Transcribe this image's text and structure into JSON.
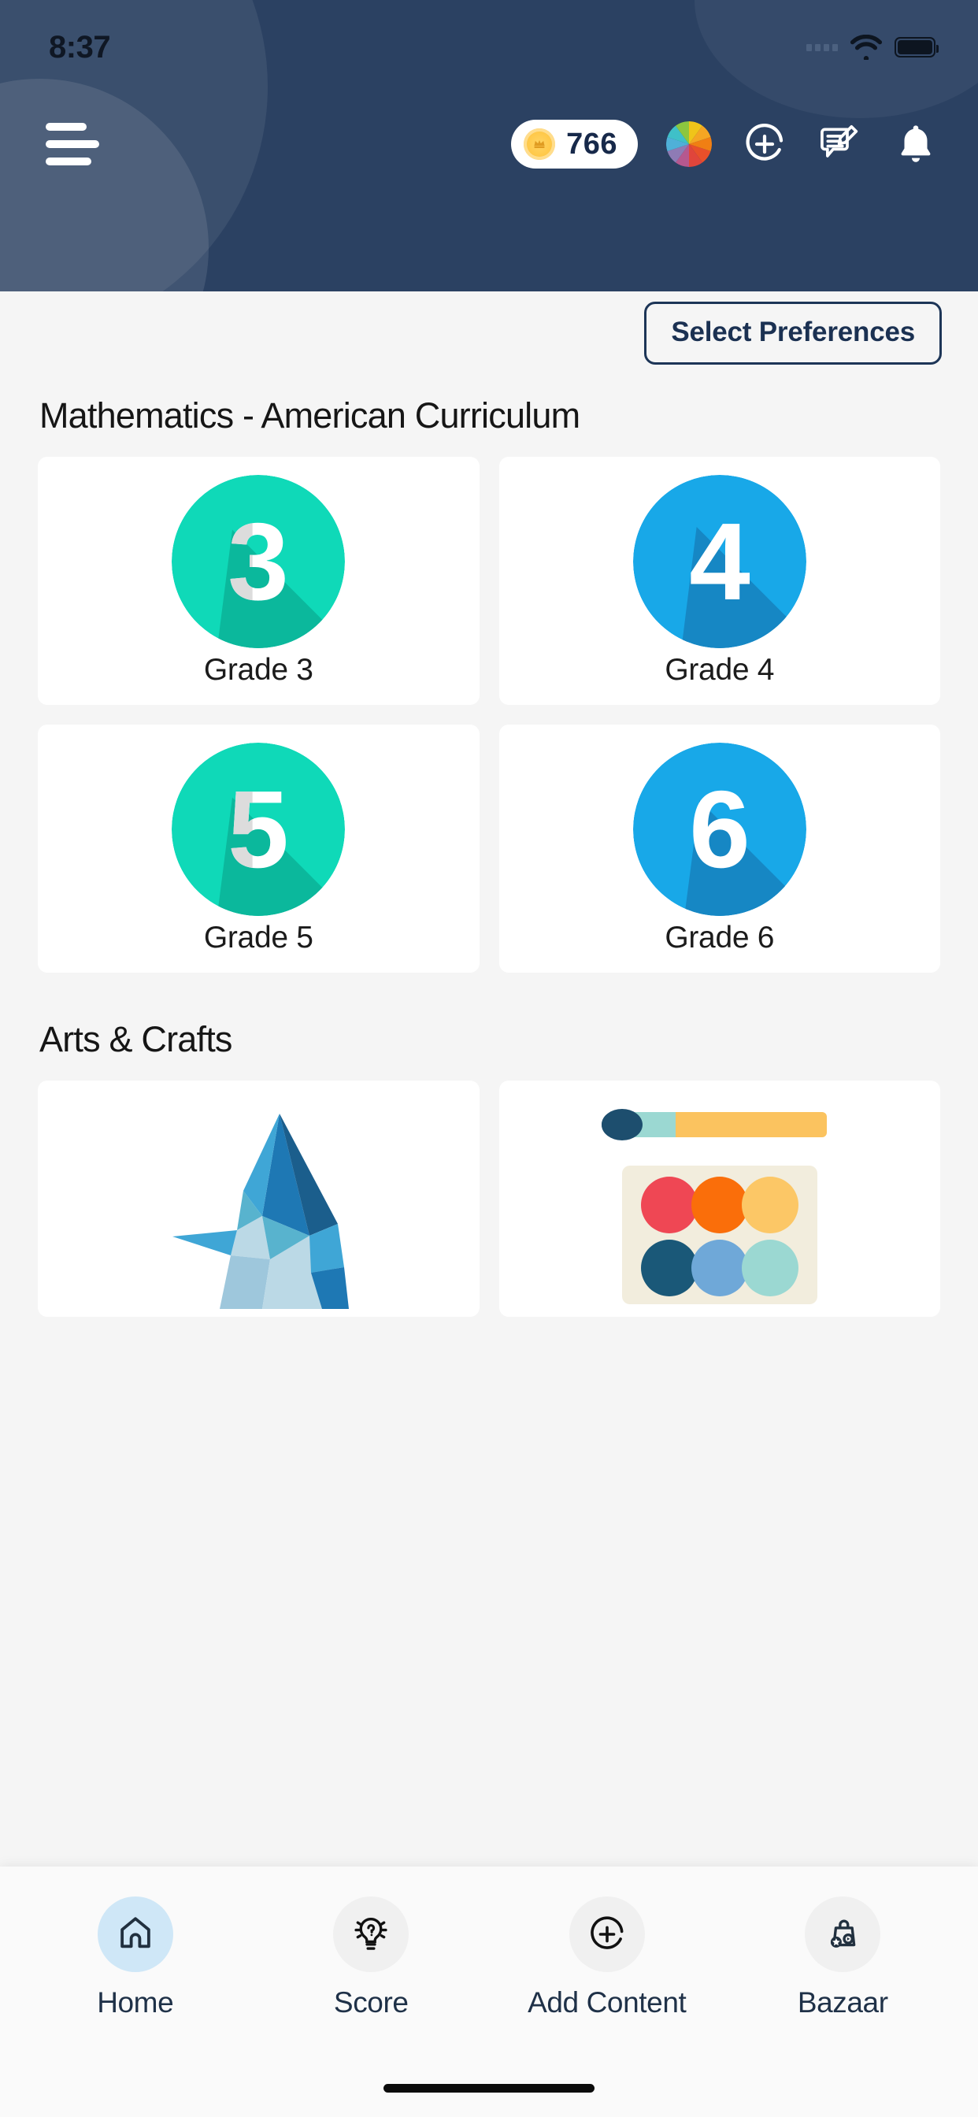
{
  "statusbar": {
    "time": "8:37",
    "wifi_icon": "wifi-icon",
    "battery_icon": "battery-icon",
    "signal_icon": "signal-dots-icon"
  },
  "header": {
    "menu_icon": "hamburger-menu-icon",
    "coins": {
      "value": "766",
      "icon": "coin-icon"
    },
    "actions": [
      {
        "name": "color-wheel-icon",
        "label": "Color Wheel"
      },
      {
        "name": "add-circle-icon",
        "label": "Add"
      },
      {
        "name": "edit-note-icon",
        "label": "Notes"
      },
      {
        "name": "bell-icon",
        "label": "Notifications"
      }
    ],
    "background_color": "#2B4162"
  },
  "toolbar": {
    "preferences_label": "Select Preferences"
  },
  "sections": [
    {
      "title": "Mathematics - American Curriculum",
      "cards": [
        {
          "label": "Grade 3",
          "number": "3",
          "color": "#0FD9B8",
          "shadow": "#0BB89C",
          "digit_color": "#FFFFFF",
          "digit_shade": "#DCDCDC"
        },
        {
          "label": "Grade 4",
          "number": "4",
          "color": "#18A8E8",
          "shadow": "#1687C4",
          "digit_color": "#FFFFFF",
          "digit_shade": "#FFFFFF"
        },
        {
          "label": "Grade 5",
          "number": "5",
          "color": "#0FD9B8",
          "shadow": "#0BB89C",
          "digit_color": "#FFFFFF",
          "digit_shade": "#DCDCDC"
        },
        {
          "label": "Grade 6",
          "number": "6",
          "color": "#18A8E8",
          "shadow": "#1687C4",
          "digit_color": "#FFFFFF",
          "digit_shade": "#FFFFFF"
        }
      ]
    },
    {
      "title": "Arts & Crafts",
      "cards": [
        {
          "label": "",
          "illustration": "origami-crane-illustration"
        },
        {
          "label": "",
          "illustration": "paint-palette-illustration"
        }
      ]
    }
  ],
  "palette_colors": {
    "brush_handle": "#1D4E6E",
    "brush_ferrule": "#9BD8D2",
    "brush_body": "#FBC35F",
    "tray": "#F2EDDD",
    "dots": [
      "#EF4754",
      "#FA6E0A",
      "#FCC766",
      "#1A5878",
      "#6FA8D8",
      "#9BD8D2"
    ]
  },
  "origami_colors": {
    "dark": "#1E78B4",
    "mid": "#3FA6D6",
    "light": "#9EC7DC",
    "pale": "#BBD9E6",
    "deep": "#1B5E8C",
    "teal": "#58B3CE"
  },
  "bottom_nav": {
    "items": [
      {
        "label": "Home",
        "icon": "home-icon",
        "active": true
      },
      {
        "label": "Score",
        "icon": "lightbulb-question-icon",
        "active": false
      },
      {
        "label": "Add Content",
        "icon": "add-circle-icon",
        "active": false
      },
      {
        "label": "Bazaar",
        "icon": "shopping-bag-star-icon",
        "active": false
      }
    ],
    "active_color": "#CFE7F7",
    "label_color": "#1F3148"
  }
}
